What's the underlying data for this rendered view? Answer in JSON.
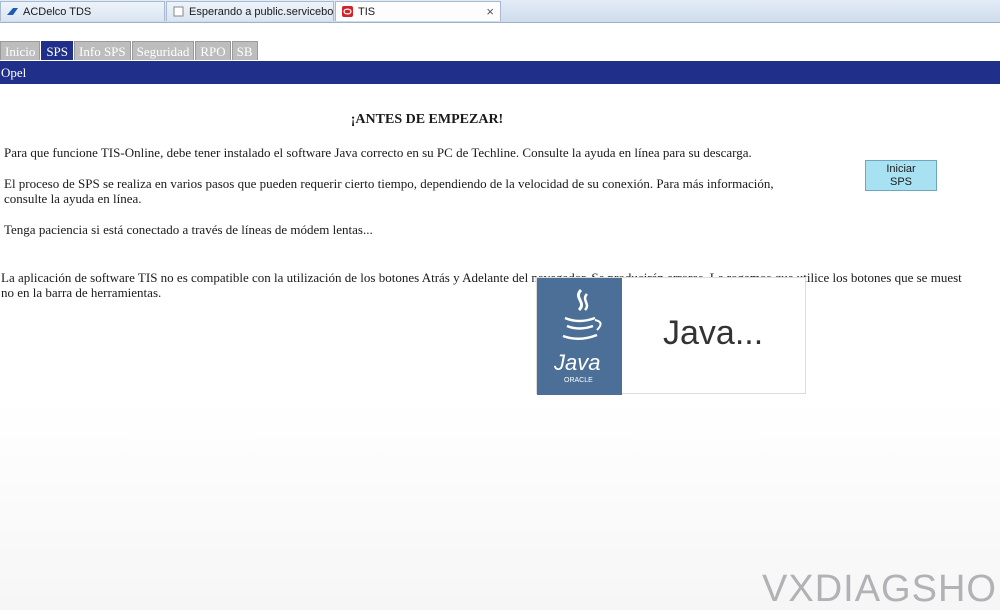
{
  "browser": {
    "tabs": [
      {
        "label": "ACDelco TDS"
      },
      {
        "label": "Esperando a public.servicebox-..."
      },
      {
        "label": "TIS"
      }
    ]
  },
  "app": {
    "tabs": [
      "Inicio",
      "SPS",
      "Info SPS",
      "Seguridad",
      "RPO",
      "SB"
    ],
    "brand": "Opel"
  },
  "content": {
    "heading": "¡ANTES DE EMPEZAR!",
    "para1": "Para que funcione TIS-Online, debe tener instalado el software Java correcto en su PC de Techline. Consulte la ayuda en línea para su descarga.",
    "para2": "El proceso de SPS se realiza en varios pasos que pueden requerir cierto tiempo, dependiendo de la velocidad de su conexión. Para más información, consulte la ayuda en línea.",
    "para3": "Tenga paciencia si está conectado a través de líneas de módem lentas...",
    "warning_line1": "La aplicación de software TIS no es compatible con la utilización de los botones Atrás y Adelante del navegador. Se producirán errores. Le rogamos que utilice los botones que se muest",
    "warning_line2": "no en la barra de herramientas.",
    "start_button": {
      "line1": "Iniciar",
      "line2": "SPS"
    }
  },
  "java_splash": {
    "logo_word": "Java",
    "logo_sub": "ORACLE",
    "text": "Java..."
  },
  "watermark": "VXDIAGSHOP",
  "colors": {
    "nav": "#1f2f8a",
    "button": "#a8e1f2",
    "java_blue": "#4b6f96"
  }
}
